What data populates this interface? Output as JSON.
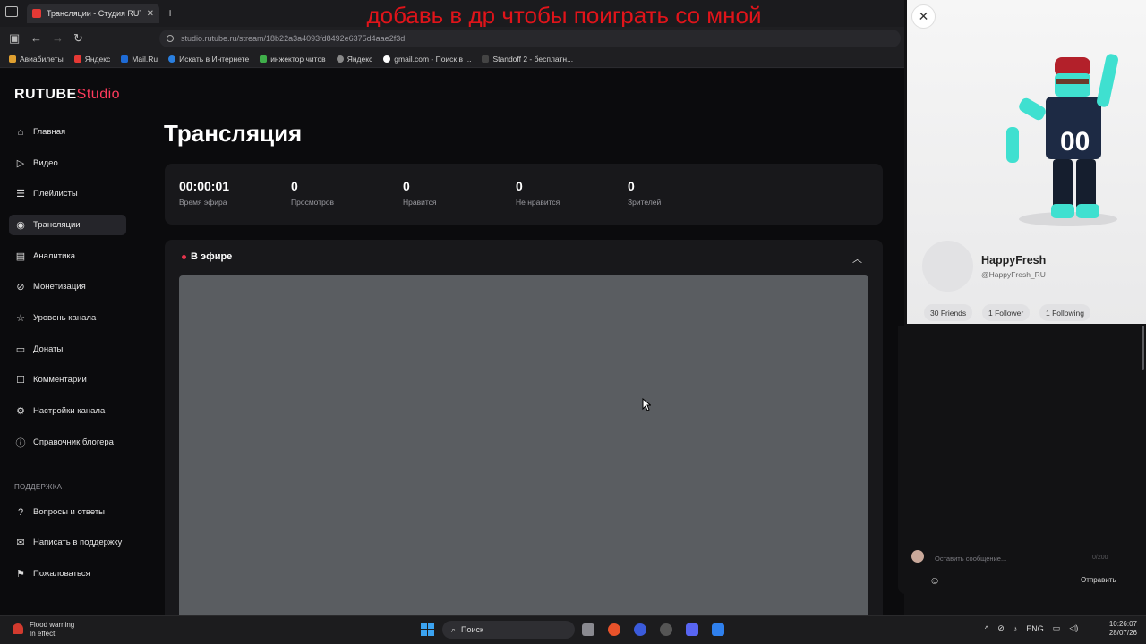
{
  "browser": {
    "tab_title": "Трансляции - Студия RUTUBE",
    "url": "studio.rutube.ru/stream/18b22a3a4093fd8492e6375d4aae2f3d",
    "bookmarks": [
      "Авиабилеты",
      "Яндекс",
      "Mail.Ru",
      "Искать в Интернете",
      "инжектор читов",
      "Яндекс",
      "gmail.com - Поиск в ...",
      "Standoff 2 - бесплатн..."
    ]
  },
  "overlay_banner": "добавь в др чтобы поиграть со мной",
  "logo": {
    "brand": "RUTUBE",
    "suffix": "Studio"
  },
  "sidebar": {
    "items": [
      {
        "label": "Главная",
        "icon": "home-icon"
      },
      {
        "label": "Видео",
        "icon": "video-icon"
      },
      {
        "label": "Плейлисты",
        "icon": "playlist-icon"
      },
      {
        "label": "Трансляции",
        "icon": "broadcast-icon"
      },
      {
        "label": "Аналитика",
        "icon": "analytics-icon"
      },
      {
        "label": "Монетизация",
        "icon": "monetization-icon"
      },
      {
        "label": "Уровень канала",
        "icon": "star-icon"
      },
      {
        "label": "Донаты",
        "icon": "donate-icon"
      },
      {
        "label": "Комментарии",
        "icon": "comments-icon"
      },
      {
        "label": "Настройки канала",
        "icon": "settings-icon"
      },
      {
        "label": "Справочник блогера",
        "icon": "info-icon"
      }
    ],
    "support_heading": "ПОДДЕРЖКА",
    "support_items": [
      {
        "label": "Вопросы и ответы",
        "icon": "help-icon"
      },
      {
        "label": "Написать в поддержку",
        "icon": "mail-icon"
      },
      {
        "label": "Пожаловаться",
        "icon": "flag-icon"
      }
    ]
  },
  "main": {
    "title": "Трансляция",
    "stats": [
      {
        "value": "00:00:01",
        "label": "Время эфира"
      },
      {
        "value": "0",
        "label": "Просмотров"
      },
      {
        "value": "0",
        "label": "Нравится"
      },
      {
        "value": "0",
        "label": "Не нравится"
      },
      {
        "value": "0",
        "label": "Зрителей"
      }
    ],
    "live_label": "В эфире",
    "live_color": "#e8344d"
  },
  "profile": {
    "name": "HappyFresh",
    "handle": "@HappyFresh_RU",
    "pills": [
      "30 Friends",
      "1 Follower",
      "1 Following"
    ]
  },
  "chat": {
    "placeholder": "Оставить сообщение...",
    "counter": "0/200",
    "send_label": "Отправить"
  },
  "taskbar": {
    "weather_title": "Flood warning",
    "weather_sub": "In effect",
    "search_label": "Поиск",
    "lang": "ENG",
    "time": "10:26:07",
    "date": "28/07/26"
  },
  "colors": {
    "accent": "#ff3b5c",
    "banner": "#e0141a"
  }
}
